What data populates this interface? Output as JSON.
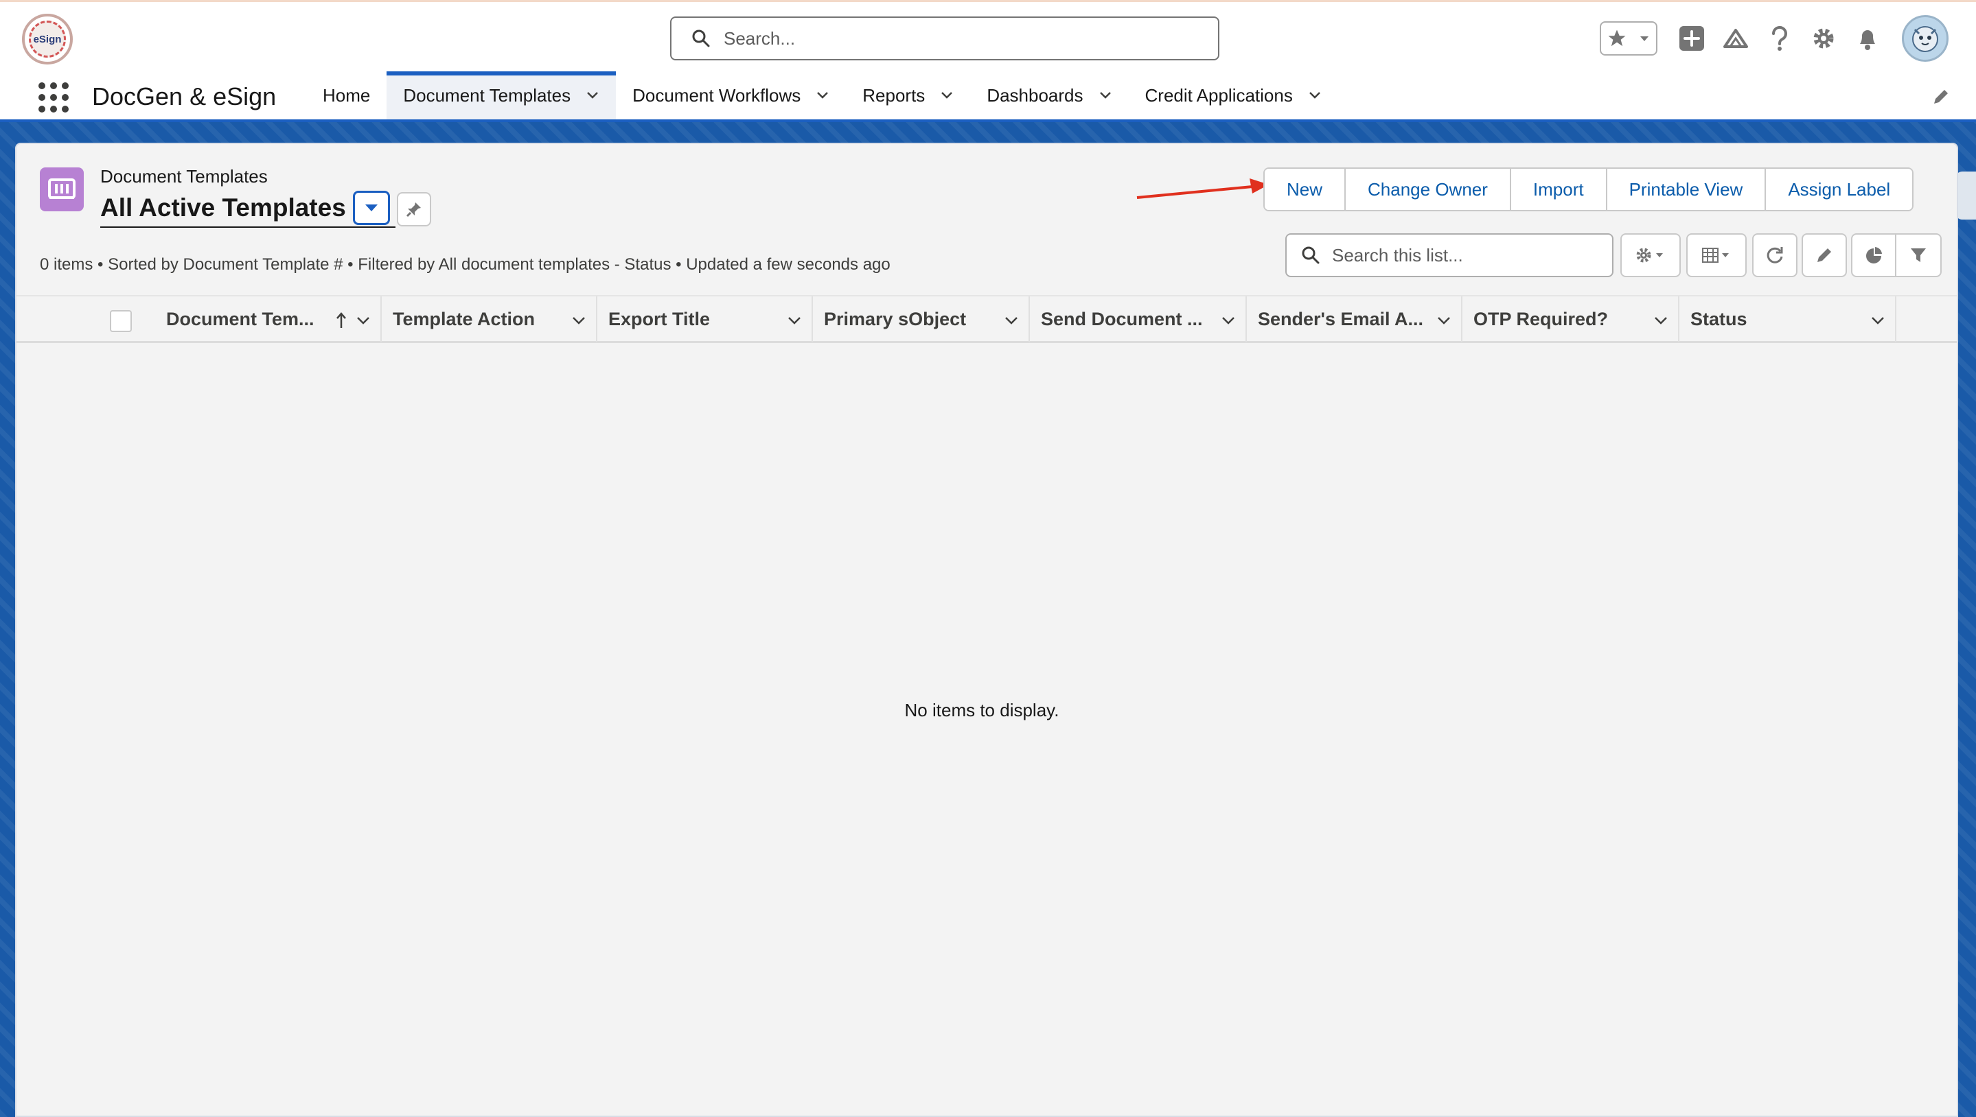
{
  "global_header": {
    "search_placeholder": "Search...",
    "logo_text": "eSign"
  },
  "nav": {
    "app_name": "DocGen & eSign",
    "items": [
      {
        "label": "Home",
        "has_menu": false,
        "active": false
      },
      {
        "label": "Document Templates",
        "has_menu": true,
        "active": true
      },
      {
        "label": "Document Workflows",
        "has_menu": true,
        "active": false
      },
      {
        "label": "Reports",
        "has_menu": true,
        "active": false
      },
      {
        "label": "Dashboards",
        "has_menu": true,
        "active": false
      },
      {
        "label": "Credit Applications",
        "has_menu": true,
        "active": false
      }
    ]
  },
  "list_view": {
    "object_label": "Document Templates",
    "title": "All Active Templates",
    "actions": [
      "New",
      "Change Owner",
      "Import",
      "Printable View",
      "Assign Label"
    ],
    "search_placeholder": "Search this list...",
    "info": "0 items • Sorted by Document Template # • Filtered by All document templates - Status • Updated a few seconds ago",
    "columns": [
      "Document Tem...",
      "Template Action",
      "Export Title",
      "Primary sObject",
      "Send Document ...",
      "Sender's Email A...",
      "OTP Required?",
      "Status"
    ],
    "empty_message": "No items to display."
  },
  "colors": {
    "brand": "#1b5fc1",
    "action_text": "#0b5cab",
    "object_icon": "#b781d3",
    "annotation_arrow": "#e0301e"
  }
}
